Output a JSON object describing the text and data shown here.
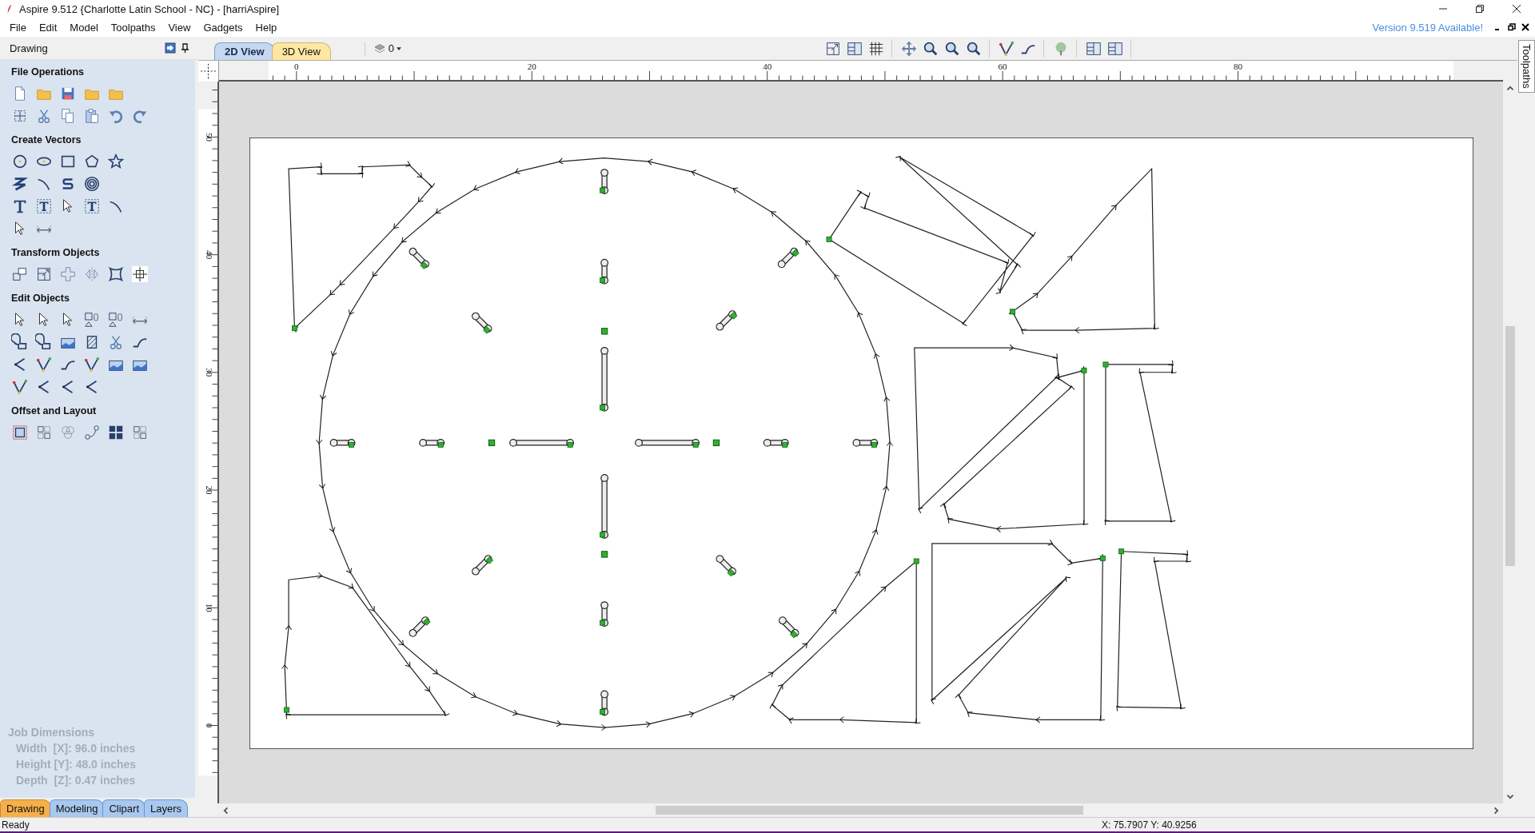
{
  "window": {
    "title": "Aspire 9.512 {Charlotte Latin School - NC} - [harriAspire]"
  },
  "menu": [
    "File",
    "Edit",
    "Model",
    "Toolpaths",
    "View",
    "Gadgets",
    "Help"
  ],
  "update_notice": "Version 9.519 Available!",
  "panel": {
    "title": "Drawing",
    "sections": [
      {
        "title": "File Operations"
      },
      {
        "title": "Create Vectors"
      },
      {
        "title": "Transform Objects"
      },
      {
        "title": "Edit Objects"
      },
      {
        "title": "Offset and Layout"
      }
    ],
    "job_dimensions": {
      "title": "Job Dimensions",
      "lines": [
        "Width  [X]: 96.0 inches",
        "Height [Y]: 48.0 inches",
        "Depth  [Z]: 0.47 inches"
      ]
    },
    "tabs": [
      {
        "label": "Drawing",
        "selected": true
      },
      {
        "label": "Modeling",
        "selected": false
      },
      {
        "label": "Clipart",
        "selected": false
      },
      {
        "label": "Layers",
        "selected": false
      }
    ]
  },
  "view_tabs": [
    {
      "label": "2D View",
      "selected": true
    },
    {
      "label": "3D View",
      "selected": false
    }
  ],
  "layer_selector": "0",
  "ruler": {
    "x_labels": [
      "0",
      "20",
      "40",
      "60",
      "80"
    ],
    "y_labels": [
      "50",
      "40",
      "30",
      "20",
      "10",
      "0"
    ]
  },
  "side_tab": "Toolpaths",
  "status_bar": {
    "message": "Ready",
    "coordinates": "X: 75.7907 Y: 40.9256"
  }
}
